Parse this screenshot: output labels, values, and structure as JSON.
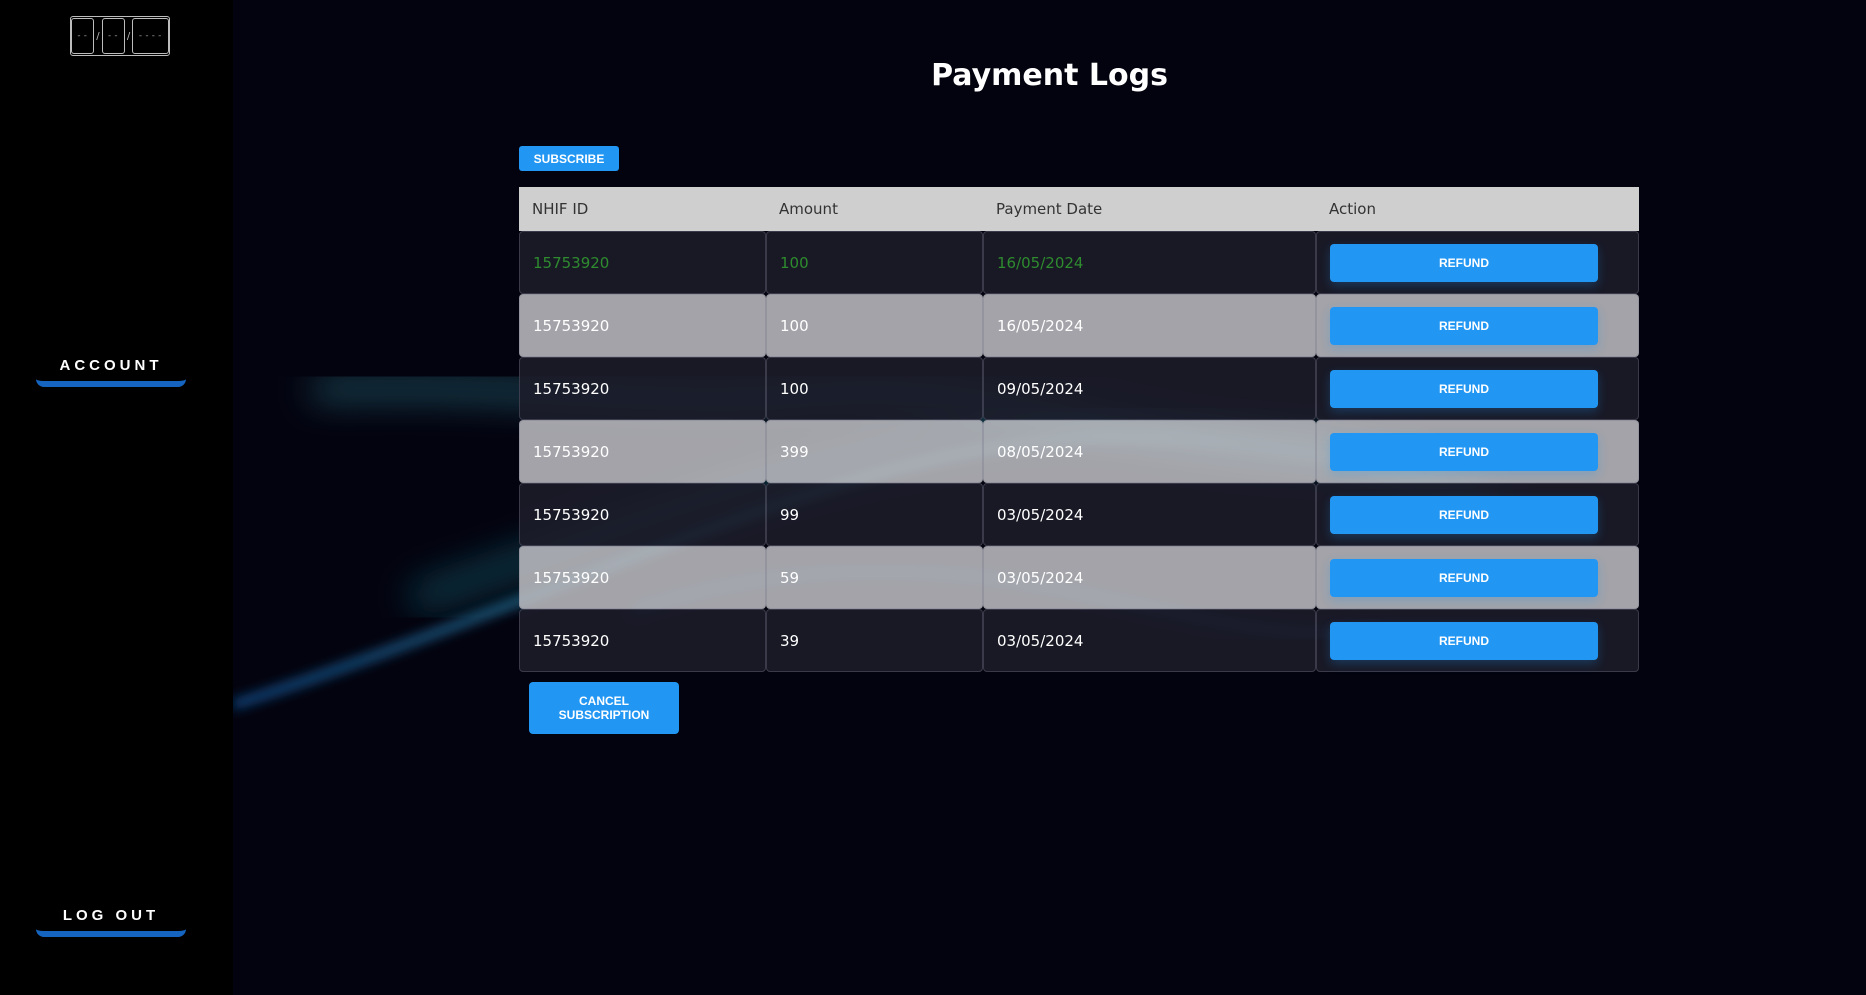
{
  "sidebar": {
    "date_widget": {
      "day": "--",
      "month": "--",
      "year": "----",
      "separator": "/"
    },
    "account_label": "ACCOUNT",
    "logout_label": "LOG OUT",
    "accent_color": "#1565c0"
  },
  "main": {
    "title": "Payment Logs",
    "subscribe_label": "SUBSCRIBE",
    "cancel_label": "CANCEL\nSUBSCRIPTION",
    "table": {
      "headers": [
        "NHIF ID",
        "Amount",
        "Payment Date",
        "Action"
      ],
      "rows": [
        {
          "nhif_id": "15753920",
          "amount": "100",
          "date": "16/05/2024",
          "action": "REFUND"
        },
        {
          "nhif_id": "15753920",
          "amount": "100",
          "date": "16/05/2024",
          "action": "REFUND"
        },
        {
          "nhif_id": "15753920",
          "amount": "100",
          "date": "09/05/2024",
          "action": "REFUND"
        },
        {
          "nhif_id": "15753920",
          "amount": "399",
          "date": "08/05/2024",
          "action": "REFUND"
        },
        {
          "nhif_id": "15753920",
          "amount": "99",
          "date": "03/05/2024",
          "action": "REFUND"
        },
        {
          "nhif_id": "15753920",
          "amount": "59",
          "date": "03/05/2024",
          "action": "REFUND"
        },
        {
          "nhif_id": "15753920",
          "amount": "39",
          "date": "03/05/2024",
          "action": "REFUND"
        }
      ]
    },
    "colors": {
      "button": "#2196f3",
      "highlight_text": "#2e8b2e",
      "background": "#03030f"
    }
  }
}
